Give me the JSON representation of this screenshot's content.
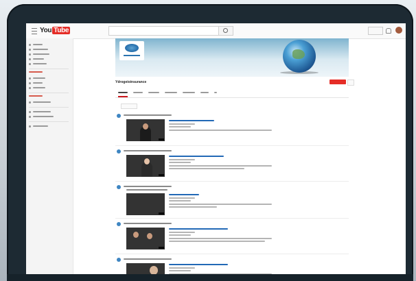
{
  "topbar": {
    "logo": {
      "you": "You",
      "tube": "Tube"
    },
    "icons": [
      "menu-icon",
      "search-icon",
      "bell-icon"
    ]
  },
  "sidebar": {
    "items": [
      {
        "name": "sidebar-item-1"
      },
      {
        "name": "sidebar-item-2"
      },
      {
        "name": "sidebar-item-3"
      },
      {
        "name": "sidebar-item-4"
      },
      {
        "name": "sidebar-item-5"
      },
      {
        "name": "sidebar-item-6"
      },
      {
        "name": "sidebar-item-7"
      },
      {
        "name": "sidebar-item-8"
      },
      {
        "name": "sidebar-item-9"
      },
      {
        "name": "sidebar-item-10"
      },
      {
        "name": "sidebar-item-11"
      },
      {
        "name": "sidebar-item-12"
      }
    ]
  },
  "channel": {
    "title": "Ydrogeioinsurance",
    "brand_color": "#e52d27",
    "accent_blue": "#2168b6"
  },
  "tabs_count": 7,
  "feed": [
    {
      "id": 1,
      "thumb": "t1"
    },
    {
      "id": 2,
      "thumb": "t2"
    },
    {
      "id": 3,
      "thumb": "t3"
    },
    {
      "id": 4,
      "thumb": "t4"
    },
    {
      "id": 5,
      "thumb": "t5"
    }
  ]
}
